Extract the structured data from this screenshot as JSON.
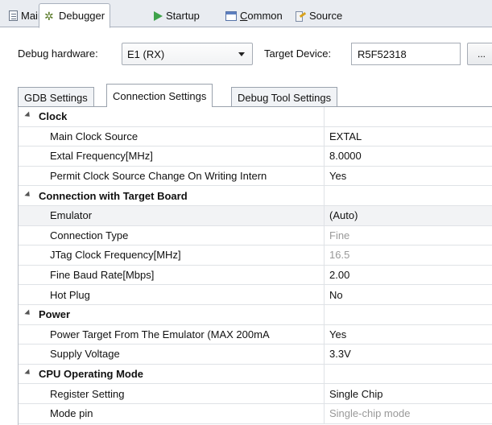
{
  "top_tabs": [
    {
      "label_pre": "Main",
      "label_u": "",
      "label_post": "",
      "icon": "document-icon"
    },
    {
      "label_pre": "Debugger",
      "label_u": "",
      "label_post": "",
      "icon": "bug-icon"
    },
    {
      "label_pre": "Startup",
      "label_u": "",
      "label_post": "",
      "icon": "play-icon"
    },
    {
      "label_pre": "",
      "label_u": "C",
      "label_post": "ommon",
      "icon": "window-icon"
    },
    {
      "label_pre": "Source",
      "label_u": "",
      "label_post": "",
      "icon": "source-icon"
    }
  ],
  "hardware": {
    "debug_hardware_label": "Debug hardware:",
    "debug_hardware_value": "E1 (RX)",
    "target_device_label": "Target Device:",
    "target_device_value": "R5F52318",
    "browse_label": "..."
  },
  "inner_tabs": [
    "GDB Settings",
    "Connection Settings",
    "Debug Tool Settings"
  ],
  "properties": [
    {
      "kind": "cat",
      "name": "Clock",
      "value": ""
    },
    {
      "kind": "prop",
      "name": "Main Clock Source",
      "value": "EXTAL"
    },
    {
      "kind": "prop",
      "name": "Extal Frequency[MHz]",
      "value": "8.0000"
    },
    {
      "kind": "prop",
      "name": "Permit Clock Source Change On Writing Intern",
      "value": "Yes"
    },
    {
      "kind": "cat",
      "name": "Connection with Target Board",
      "value": ""
    },
    {
      "kind": "prop",
      "name": "Emulator",
      "value": "(Auto)"
    },
    {
      "kind": "prop",
      "name": "Connection Type",
      "value": "Fine",
      "disabled": true
    },
    {
      "kind": "prop",
      "name": "JTag Clock Frequency[MHz]",
      "value": "16.5",
      "disabled": true
    },
    {
      "kind": "prop",
      "name": "Fine Baud Rate[Mbps]",
      "value": "2.00"
    },
    {
      "kind": "prop",
      "name": "Hot Plug",
      "value": "No"
    },
    {
      "kind": "cat",
      "name": "Power",
      "value": ""
    },
    {
      "kind": "prop",
      "name": "Power Target From The Emulator (MAX 200mA",
      "value": "Yes"
    },
    {
      "kind": "prop",
      "name": "Supply Voltage",
      "value": "3.3V"
    },
    {
      "kind": "cat",
      "name": "CPU Operating Mode",
      "value": ""
    },
    {
      "kind": "prop",
      "name": "Register Setting",
      "value": "Single Chip"
    },
    {
      "kind": "prop",
      "name": "Mode pin",
      "value": "Single-chip mode",
      "disabled": true
    }
  ]
}
